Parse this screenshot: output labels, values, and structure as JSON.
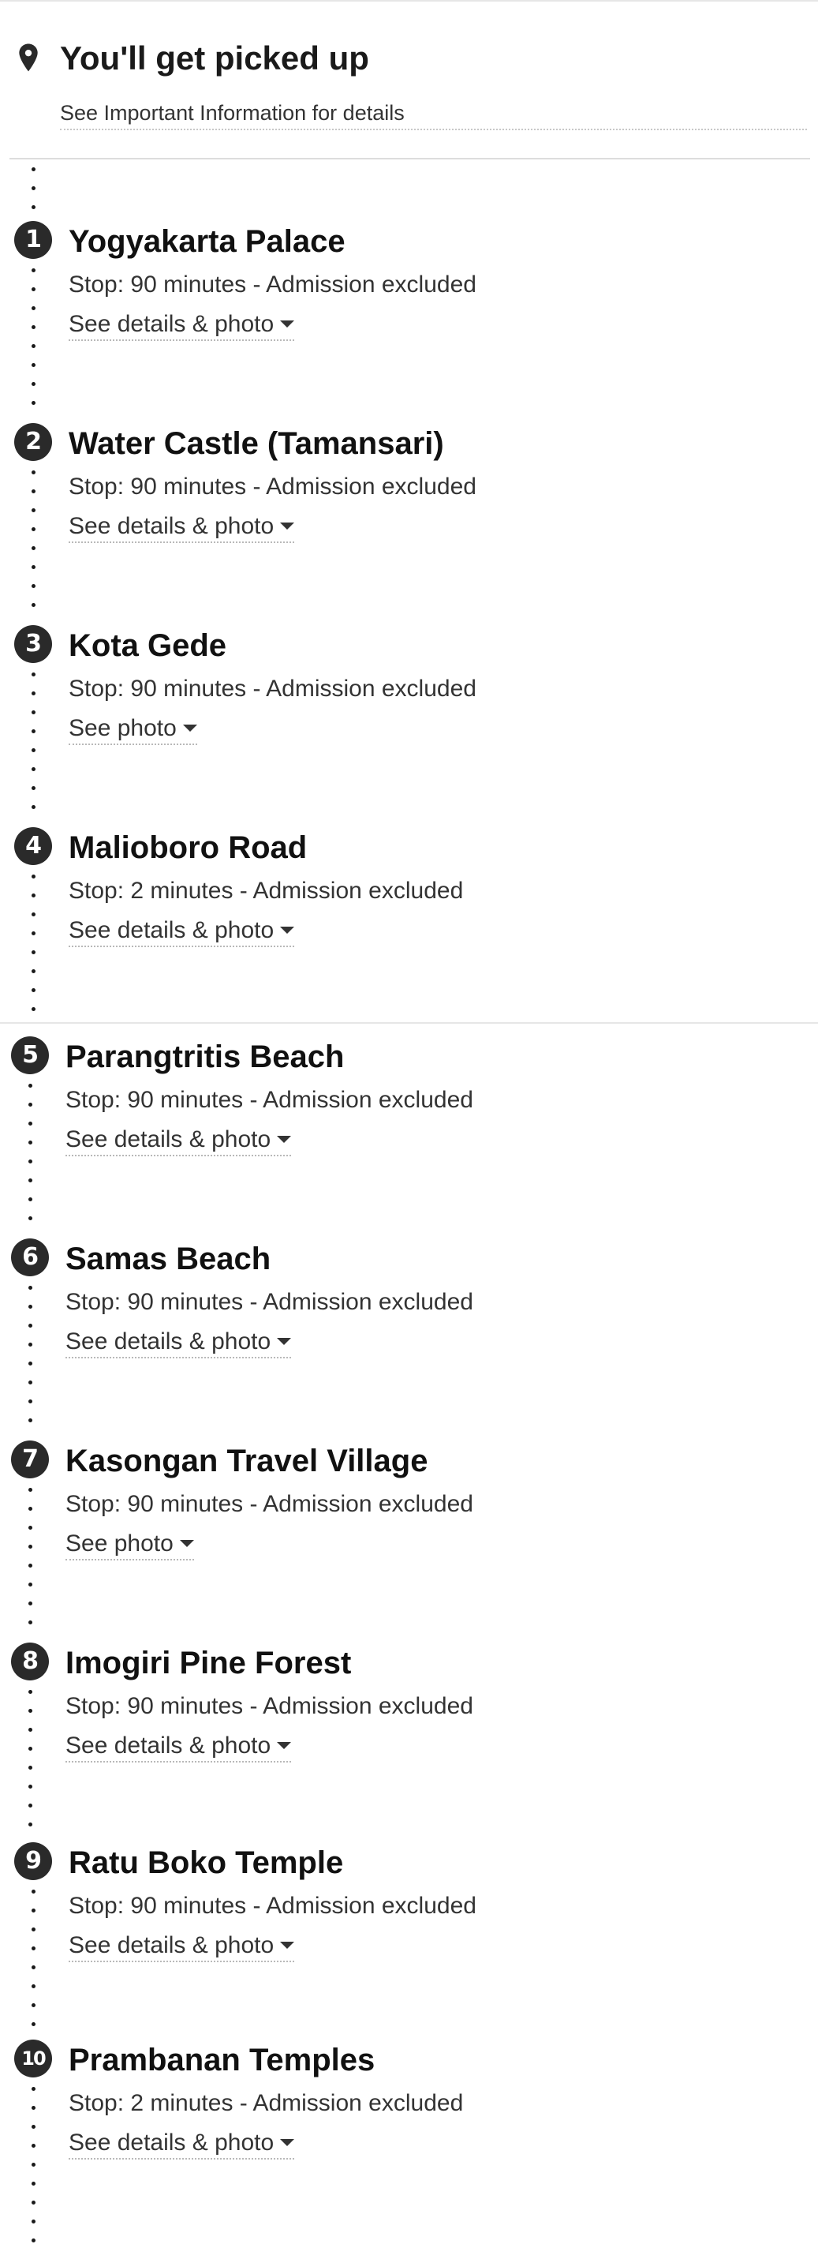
{
  "pickup": {
    "title": "You'll get picked up",
    "subtitle": "See Important Information for details",
    "icon": "location-pin-icon"
  },
  "stops": [
    {
      "number": "1",
      "name": "Yogyakarta Palace",
      "meta": "Stop: 90 minutes - Admission excluded",
      "link": "See details & photo"
    },
    {
      "number": "2",
      "name": "Water Castle (Tamansari)",
      "meta": "Stop: 90 minutes - Admission excluded",
      "link": "See details & photo"
    },
    {
      "number": "3",
      "name": "Kota Gede",
      "meta": "Stop: 90 minutes - Admission excluded",
      "link": "See photo"
    },
    {
      "number": "4",
      "name": "Malioboro Road",
      "meta": "Stop: 2 minutes - Admission excluded",
      "link": "See details & photo"
    },
    {
      "number": "5",
      "name": "Parangtritis Beach",
      "meta": "Stop: 90 minutes - Admission excluded",
      "link": "See details & photo"
    },
    {
      "number": "6",
      "name": "Samas Beach",
      "meta": "Stop: 90 minutes - Admission excluded",
      "link": "See details & photo"
    },
    {
      "number": "7",
      "name": "Kasongan Travel Village",
      "meta": "Stop: 90 minutes - Admission excluded",
      "link": "See photo"
    },
    {
      "number": "8",
      "name": "Imogiri Pine Forest",
      "meta": "Stop: 90 minutes - Admission excluded",
      "link": "See details & photo"
    },
    {
      "number": "9",
      "name": "Ratu Boko Temple",
      "meta": "Stop: 90 minutes - Admission excluded",
      "link": "See details & photo"
    },
    {
      "number": "10",
      "name": "Prambanan Temples",
      "meta": "Stop: 2 minutes - Admission excluded",
      "link": "See details & photo"
    }
  ],
  "colors": {
    "text": "#1a1a1a",
    "badge": "#2a2a2a",
    "divider": "#e6e6e6"
  }
}
